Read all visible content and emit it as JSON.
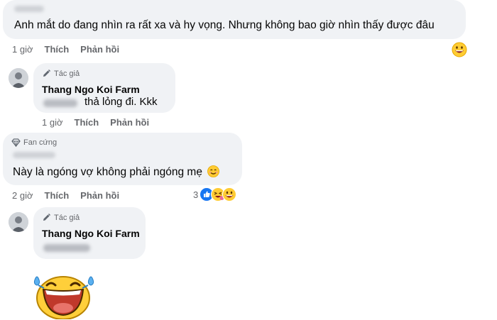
{
  "comments": [
    {
      "text": "Anh mắt do đang nhìn ra rất xa và hy vọng. Nhưng không bao giờ nhìn thấy được đâu",
      "time": "1 giờ",
      "like_label": "Thích",
      "reply_label": "Phản hồi",
      "reaction_icon": "grinning-face-icon"
    },
    {
      "badge": "Tác giả",
      "author": "Thang Ngo Koi Farm",
      "text": "thả lỏng đi. Kkk",
      "time": "1 giờ",
      "like_label": "Thích",
      "reply_label": "Phản hồi"
    },
    {
      "badge": "Fan cứng",
      "text": "Này là ngóng vợ không phải ngóng mẹ",
      "time": "2 giờ",
      "like_label": "Thích",
      "reply_label": "Phản hồi",
      "reaction_count": "3",
      "reaction_icons": [
        "like-icon",
        "haha-icon",
        "laughing-icon"
      ]
    },
    {
      "badge": "Tác giả",
      "author": "Thang Ngo Koi Farm",
      "sticker": "tears-of-joy-sticker"
    }
  ],
  "colors": {
    "bubble": "#f0f2f5",
    "meta_text": "#65676b",
    "like_blue": "#1877f2",
    "emoji_yellow": "#ffcc33"
  }
}
